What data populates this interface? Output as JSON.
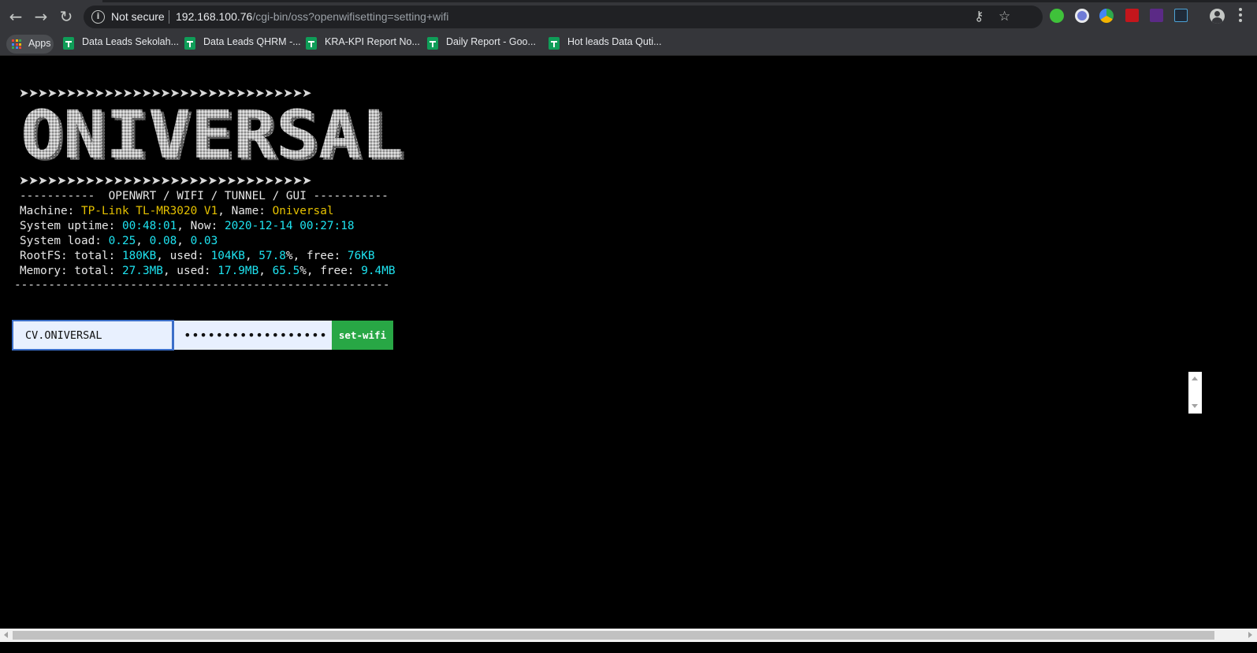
{
  "browser": {
    "security_label": "Not secure",
    "url_host": "192.168.100.76",
    "url_path": "/cgi-bin/oss?openwifisetting=setting+wifi",
    "bookmarks": [
      {
        "label": "Apps"
      },
      {
        "label": "Data Leads Sekolah..."
      },
      {
        "label": "Data Leads QHRM -..."
      },
      {
        "label": "KRA-KPI Report No..."
      },
      {
        "label": "Daily Report - Goo..."
      },
      {
        "label": "Hot leads Data Quti..."
      }
    ],
    "icons": [
      "back-icon",
      "forward-icon",
      "reload-icon",
      "info-icon",
      "key-icon",
      "star-icon",
      "profile-icon",
      "menu-icon"
    ]
  },
  "banner": {
    "arrows": "➤➤➤➤➤➤➤➤➤➤➤➤➤➤➤➤➤➤➤➤➤➤➤➤➤➤➤➤➤➤➤",
    "logo_text": "ONIVERSAL",
    "subtitle": "-----------  OPENWRT / WIFI / TUNNEL / GUI -----------",
    "divider": "-------------------------------------------------------"
  },
  "system": {
    "machine_label": "Machine: ",
    "machine": "TP-Link TL-MR3020 V1",
    "name_label": ", Name: ",
    "name": "Oniversal",
    "uptime_label": "System uptime: ",
    "uptime": "00:48:01",
    "now_label": ", Now: ",
    "now": "2020-12-14 00:27:18",
    "load_label": "System load: ",
    "load1": "0.25",
    "load5": "0.08",
    "load15": "0.03",
    "sep": ", ",
    "rootfs_label": "RootFS: total: ",
    "rootfs_total": "180KB",
    "rootfs_used_label": ", used: ",
    "rootfs_used": "104KB",
    "rootfs_pct": "57.8",
    "pct_sign": "%",
    "rootfs_free_label": ", free: ",
    "rootfs_free": "76KB",
    "mem_label": "Memory: total: ",
    "mem_total": "27.3MB",
    "mem_used_label": ", used: ",
    "mem_used": "17.9MB",
    "mem_pct": "65.5",
    "mem_free_label": ", free: ",
    "mem_free": "9.4MB"
  },
  "form": {
    "ssid_value": "CV.ONIVERSAL",
    "password_value": "••••••••••••••••••",
    "submit_label": "set-wifi"
  },
  "colors": {
    "highlight_yellow": "#e5c100",
    "highlight_cyan": "#1ee3f0",
    "submit_green": "#28a745"
  }
}
